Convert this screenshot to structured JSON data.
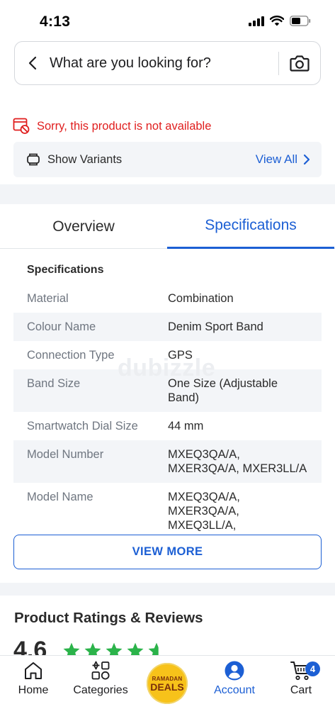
{
  "status_bar": {
    "time": "4:13"
  },
  "search": {
    "placeholder": "What are you looking for?"
  },
  "availability": {
    "message": "Sorry, this product is not available"
  },
  "variants": {
    "label": "Show Variants",
    "link": "View All"
  },
  "tabs": [
    {
      "label": "Overview",
      "active": false
    },
    {
      "label": "Specifications",
      "active": true
    }
  ],
  "specifications": {
    "heading": "Specifications",
    "rows": [
      {
        "key": "Material",
        "value": "Combination"
      },
      {
        "key": "Colour Name",
        "value": "Denim Sport Band"
      },
      {
        "key": "Connection Type",
        "value": "GPS"
      },
      {
        "key": "Band Size",
        "value": "One Size (Adjustable Band)"
      },
      {
        "key": "Smartwatch Dial Size",
        "value": "44 mm"
      },
      {
        "key": "Model Number",
        "value": "MXEQ3QA/A, MXER3QA/A, MXER3LL/A"
      },
      {
        "key": "Model Name",
        "value": "MXEQ3QA/A, MXER3QA/A, MXEQ3LL/A,"
      }
    ],
    "watermark": "dubizzle",
    "view_more": "VIEW MORE"
  },
  "ratings": {
    "title": "Product Ratings & Reviews",
    "score": "4.6",
    "stars": 4.6
  },
  "bottom_nav": {
    "home": "Home",
    "categories": "Categories",
    "deals_top": "RAMADAN",
    "deals_bottom": "DEALS",
    "account": "Account",
    "cart": "Cart",
    "cart_count": "4"
  },
  "colors": {
    "accent": "#1c5fd4",
    "error": "#e01e1e",
    "star": "#2bb34a",
    "deals": "#f7c21a"
  }
}
